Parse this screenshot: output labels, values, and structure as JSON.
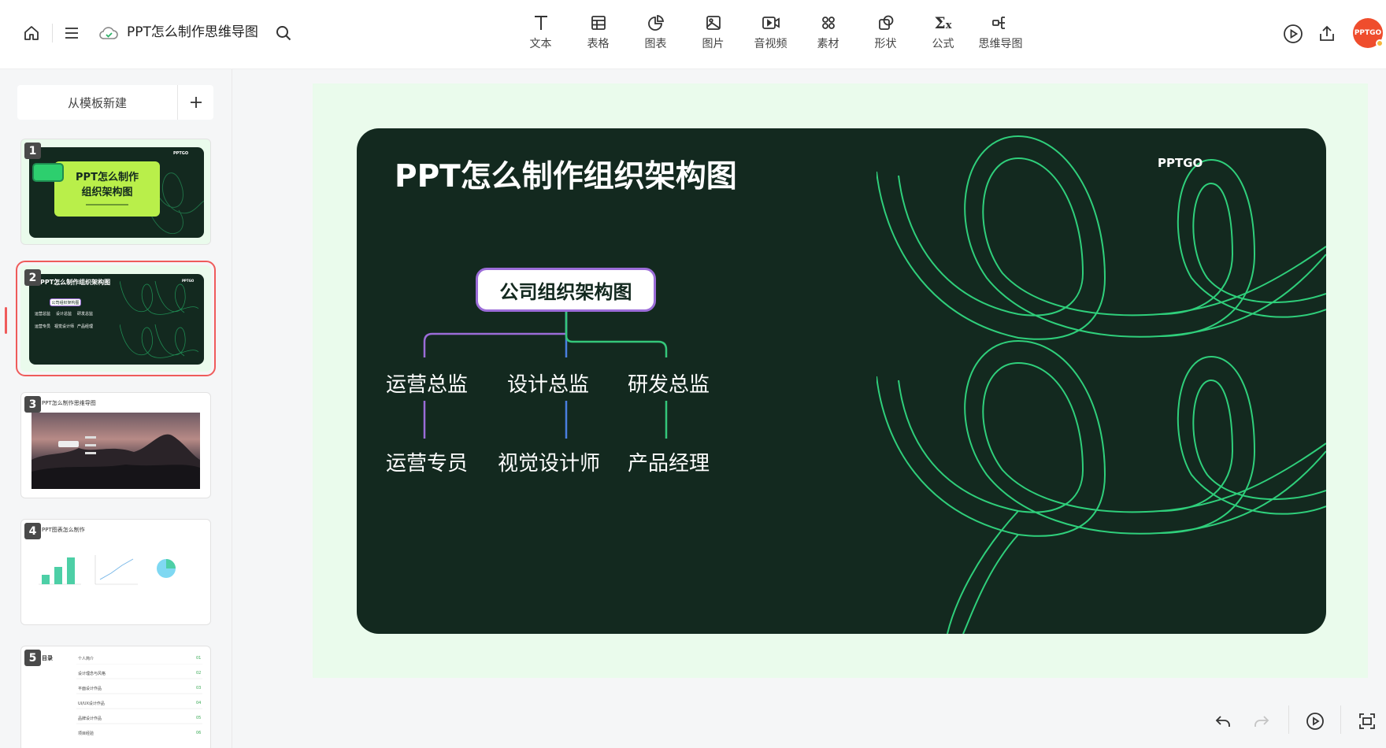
{
  "doc": {
    "title": "PPT怎么制作思维导图"
  },
  "toolbar": [
    {
      "label": "文本",
      "icon": "text-icon"
    },
    {
      "label": "表格",
      "icon": "table-icon"
    },
    {
      "label": "图表",
      "icon": "chart-icon"
    },
    {
      "label": "图片",
      "icon": "image-icon"
    },
    {
      "label": "音视频",
      "icon": "video-icon"
    },
    {
      "label": "素材",
      "icon": "assets-icon"
    },
    {
      "label": "形状",
      "icon": "shape-icon"
    },
    {
      "label": "公式",
      "icon": "formula-icon"
    },
    {
      "label": "思维导图",
      "icon": "mindmap-icon"
    }
  ],
  "user": {
    "avatar_text": "PPTGO"
  },
  "sidebar": {
    "new_from_template": "从模板新建",
    "slides": [
      {
        "num": "1",
        "title_line1": "PPT怎么制作",
        "title_line2": "组织架构图",
        "brand": "PPTGO"
      },
      {
        "num": "2",
        "title": "PPT怎么制作组织架构图",
        "root": "公司组织架构图",
        "row1": [
          "运营总监",
          "设计总监",
          "研发总监"
        ],
        "row2": [
          "运营专员",
          "视觉设计师",
          "产品经理"
        ],
        "brand": "PPTGO"
      },
      {
        "num": "3",
        "title": "PPT怎么制作思维导图"
      },
      {
        "num": "4",
        "title": "PPT图表怎么制作"
      },
      {
        "num": "5",
        "title": "目录",
        "items": [
          {
            "name": "个人简介",
            "page": "01"
          },
          {
            "name": "设计理念与风格",
            "page": "02"
          },
          {
            "name": "平面设计作品",
            "page": "03"
          },
          {
            "name": "UI/UX设计作品",
            "page": "04"
          },
          {
            "name": "品牌设计作品",
            "page": "05"
          },
          {
            "name": "项目经验",
            "page": "06"
          }
        ]
      }
    ]
  },
  "slide": {
    "title": "PPT怎么制作组织架构图",
    "brand": "PPTGO",
    "root": "公司组织架构图",
    "row1": [
      "运营总监",
      "设计总监",
      "研发总监"
    ],
    "row2": [
      "运营专员",
      "视觉设计师",
      "产品经理"
    ],
    "colors": {
      "background": "#13291f",
      "purple": "#9b6cd8",
      "blue": "#4a7fe0",
      "green": "#34c77a",
      "frame": "#eafbec"
    }
  }
}
